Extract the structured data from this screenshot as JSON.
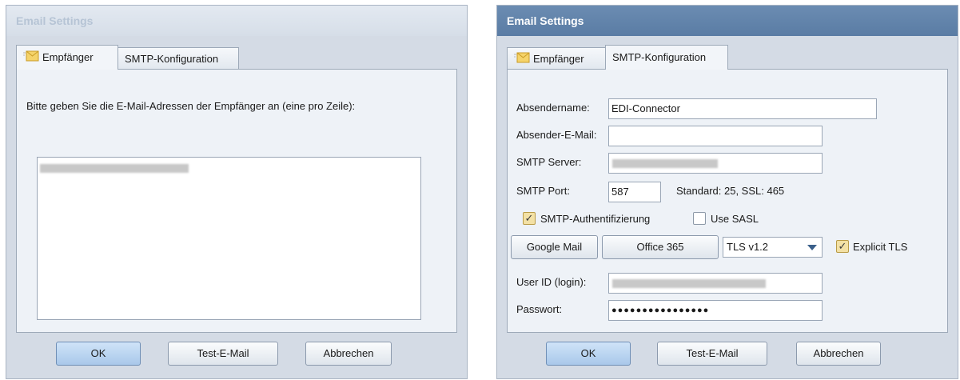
{
  "left_window": {
    "title": "Email Settings",
    "tabs": [
      "Empfänger",
      "SMTP-Konfiguration"
    ],
    "instruction": "Bitte geben Sie die E-Mail-Adressen der Empfänger an (eine pro Zeile):",
    "buttons": {
      "ok": "OK",
      "test": "Test-E-Mail",
      "cancel": "Abbrechen"
    }
  },
  "right_window": {
    "title": "Email Settings",
    "tabs": [
      "Empfänger",
      "SMTP-Konfiguration"
    ],
    "fields": {
      "sender_name_label": "Absendername:",
      "sender_name_value": "EDI-Connector",
      "sender_email_label": "Absender-E-Mail:",
      "smtp_server_label": "SMTP Server:",
      "smtp_port_label": "SMTP Port:",
      "smtp_port_value": "587",
      "port_hint": "Standard: 25,  SSL: 465",
      "user_label": "User ID (login):",
      "password_label": "Passwort:",
      "password_value": "●●●●●●●●●●●●●●●●"
    },
    "checkboxes": {
      "smtp_auth": {
        "label": "SMTP-Authentifizierung",
        "checked": true
      },
      "use_sasl": {
        "label": "Use SASL",
        "checked": false
      },
      "explicit_tls": {
        "label": "Explicit TLS",
        "checked": true
      }
    },
    "preset_buttons": {
      "google": "Google Mail",
      "office": "Office 365"
    },
    "tls_select": {
      "selected": "TLS v1.2"
    },
    "buttons": {
      "ok": "OK",
      "test": "Test-E-Mail",
      "cancel": "Abbrechen"
    }
  },
  "icons": {
    "tab_icon": "envelope-icon",
    "checkmark": "✓"
  }
}
